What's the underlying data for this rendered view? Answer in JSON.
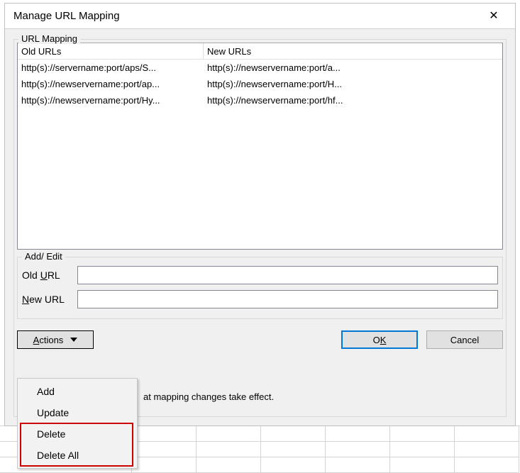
{
  "dialog": {
    "title": "Manage URL Mapping"
  },
  "groupbox": {
    "label": "URL Mapping"
  },
  "table": {
    "headers": {
      "old": "Old URLs",
      "new": "New URLs"
    },
    "rows": [
      {
        "old": "http(s)://servername:port/aps/S...",
        "new": "http(s)://newservername:port/a..."
      },
      {
        "old": "http(s)://newservername:port/ap...",
        "new": "http(s)://newservername:port/H..."
      },
      {
        "old": "http(s)://newservername:port/Hy...",
        "new": "http(s)://newservername:port/hf..."
      }
    ]
  },
  "addedit": {
    "label": "Add/ Edit",
    "old_label_pre": "Old ",
    "old_label_accel": "U",
    "old_label_post": "RL",
    "new_label_accel": "N",
    "new_label_post": "ew URL"
  },
  "buttons": {
    "actions_accel": "A",
    "actions_post": "ctions",
    "ok_pre": "O",
    "ok_accel": "K",
    "cancel": "Cancel"
  },
  "hint": "at mapping changes take effect.",
  "menu": {
    "items": [
      "Add",
      "Update",
      "Delete",
      "Delete All"
    ]
  }
}
